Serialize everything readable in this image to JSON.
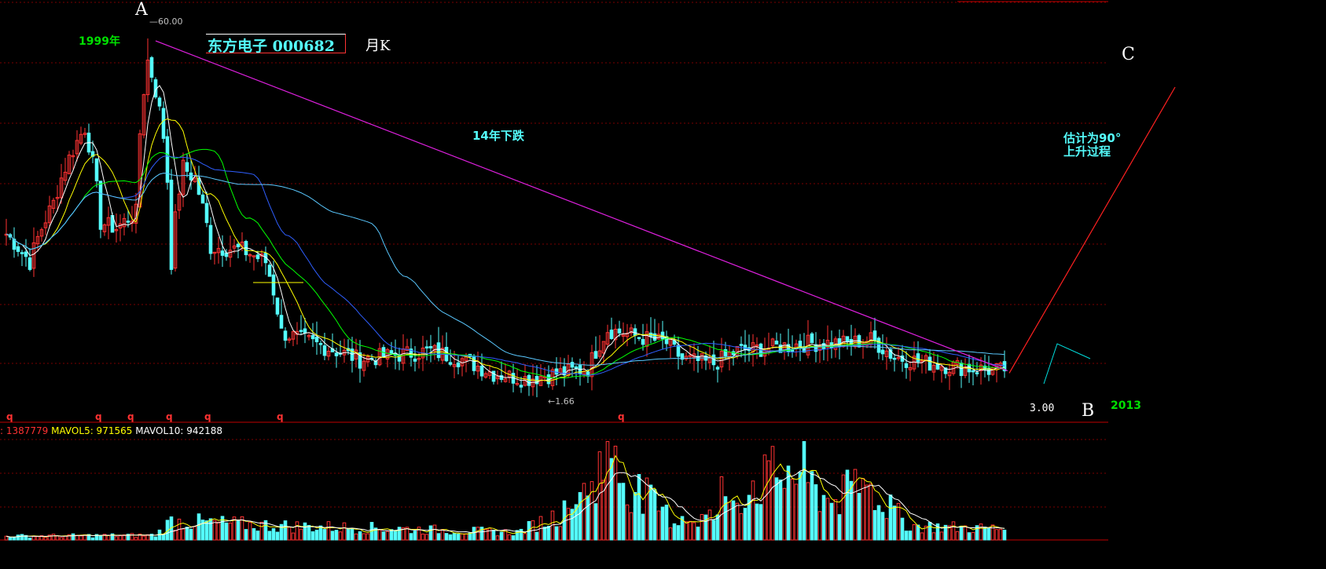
{
  "window": {
    "title": "东方电子 000682 月K"
  },
  "stock": {
    "name_code": "东方电子 000682",
    "period": "月K",
    "code": "000682"
  },
  "annotations": {
    "point_a": "A",
    "point_b": "B",
    "point_c": "C",
    "high_year": "1999年",
    "high_price": "60.00",
    "decline": "14年下跌",
    "estimate_line1": "估计为90°",
    "estimate_line2": "上升过程",
    "end_year": "2013",
    "end_price": "3.00",
    "low_price": "1.66",
    "marker": "q"
  },
  "volume_legend": {
    "vol": ": 1387779",
    "mavol5": "MAVOL5: 971565",
    "mavol10": "MAVOL10: 942188"
  },
  "colors": {
    "background": "#000000",
    "up": "#ff3232",
    "down": "#54fcfc",
    "ma1": "#ffffff",
    "ma2": "#ffff00",
    "ma3": "#00ff00",
    "ma4": "#2f5fff",
    "ma5": "#5ac8ff",
    "trend_line": "#e020e0",
    "rise_line": "#ff2020",
    "grid": "#7a0000",
    "label_green": "#00e000",
    "label_cyan": "#54fcfc"
  },
  "chart_data": [
    {
      "type": "candlestick",
      "title": "东方电子 000682 月K",
      "period": "monthly",
      "x_start": "1997",
      "x_end": "2013",
      "y_scale": "log",
      "ylim": [
        1.5,
        70
      ],
      "high": 60.0,
      "low": 1.66,
      "last_close": 3.0,
      "close_anchors": [
        {
          "x": 0,
          "close": 8
        },
        {
          "x": 6,
          "close": 6
        },
        {
          "x": 12,
          "close": 11
        },
        {
          "x": 20,
          "close": 24
        },
        {
          "x": 24,
          "close": 9
        },
        {
          "x": 28,
          "close": 8.5
        },
        {
          "x": 33,
          "close": 10
        },
        {
          "x": 36,
          "close": 48
        },
        {
          "x": 40,
          "close": 22
        },
        {
          "x": 42,
          "close": 6
        },
        {
          "x": 45,
          "close": 16
        },
        {
          "x": 48,
          "close": 14
        },
        {
          "x": 52,
          "close": 7
        },
        {
          "x": 60,
          "close": 6.8
        },
        {
          "x": 66,
          "close": 6
        },
        {
          "x": 70,
          "close": 2.9
        },
        {
          "x": 78,
          "close": 2.6
        },
        {
          "x": 90,
          "close": 2.2
        },
        {
          "x": 108,
          "close": 2.4
        },
        {
          "x": 116,
          "close": 2.2
        },
        {
          "x": 124,
          "close": 1.9
        },
        {
          "x": 132,
          "close": 1.8
        },
        {
          "x": 144,
          "close": 1.95
        },
        {
          "x": 148,
          "close": 2.0
        },
        {
          "x": 153,
          "close": 3.0
        },
        {
          "x": 160,
          "close": 2.8
        },
        {
          "x": 168,
          "close": 2.6
        },
        {
          "x": 172,
          "close": 2.2
        },
        {
          "x": 180,
          "close": 2.1
        },
        {
          "x": 186,
          "close": 2.4
        },
        {
          "x": 196,
          "close": 2.5
        },
        {
          "x": 204,
          "close": 2.6
        },
        {
          "x": 214,
          "close": 2.6
        },
        {
          "x": 220,
          "close": 2.7
        },
        {
          "x": 226,
          "close": 2.25
        },
        {
          "x": 236,
          "close": 2.1
        },
        {
          "x": 246,
          "close": 2.0
        },
        {
          "x": 254,
          "close": 1.95
        }
      ],
      "moving_averages": [
        "MA5",
        "MA10",
        "MA20",
        "MA30",
        "MA60"
      ],
      "trend_lines": [
        {
          "name": "A-B",
          "from": {
            "x": 36,
            "price": 60
          },
          "to": {
            "x": 254,
            "price": 2.0
          }
        },
        {
          "name": "B-C",
          "from": {
            "x": 254,
            "price": 2.0
          },
          "to": {
            "x": 275,
            "price": 60
          }
        }
      ]
    },
    {
      "type": "bar",
      "title": "VOL",
      "series": [
        {
          "name": "VOL",
          "last": 1387779
        },
        {
          "name": "MAVOL5",
          "last": 971565
        },
        {
          "name": "MAVOL10",
          "last": 942188
        }
      ],
      "volume_anchors": [
        {
          "x": 0,
          "v": 0.04
        },
        {
          "x": 38,
          "v": 0.05
        },
        {
          "x": 42,
          "v": 0.2
        },
        {
          "x": 70,
          "v": 0.15
        },
        {
          "x": 100,
          "v": 0.12
        },
        {
          "x": 130,
          "v": 0.08
        },
        {
          "x": 145,
          "v": 0.35
        },
        {
          "x": 152,
          "v": 0.85
        },
        {
          "x": 160,
          "v": 0.55
        },
        {
          "x": 170,
          "v": 0.2
        },
        {
          "x": 180,
          "v": 0.25
        },
        {
          "x": 190,
          "v": 0.6
        },
        {
          "x": 200,
          "v": 0.75
        },
        {
          "x": 210,
          "v": 0.4
        },
        {
          "x": 218,
          "v": 0.6
        },
        {
          "x": 230,
          "v": 0.15
        },
        {
          "x": 254,
          "v": 0.12
        }
      ],
      "ylim": [
        0,
        1
      ]
    }
  ]
}
